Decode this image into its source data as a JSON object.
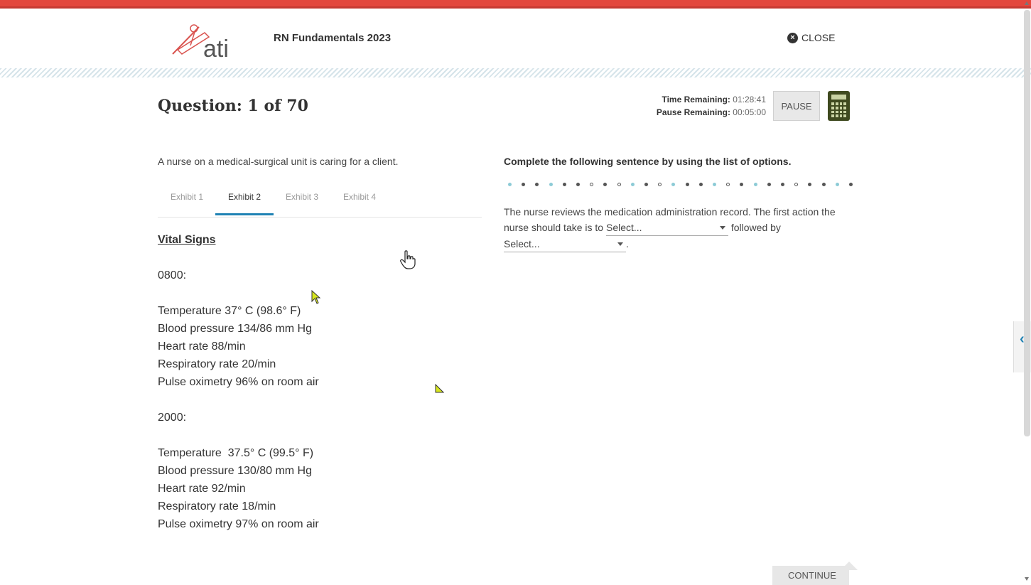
{
  "header": {
    "logo_text": "ati",
    "app_title": "RN Fundamentals 2023",
    "close_label": "CLOSE"
  },
  "question": {
    "title": "Question: 1 of 70",
    "time_remaining_label": "Time Remaining:",
    "time_remaining_value": "01:28:41",
    "pause_remaining_label": "Pause Remaining:",
    "pause_remaining_value": "00:05:00",
    "pause_label": "PAUSE"
  },
  "stem": "A nurse on a medical-surgical unit is caring for a client.",
  "tabs": [
    {
      "label": "Exhibit 1",
      "active": false
    },
    {
      "label": "Exhibit 2",
      "active": true
    },
    {
      "label": "Exhibit 3",
      "active": false
    },
    {
      "label": "Exhibit 4",
      "active": false
    }
  ],
  "exhibit": {
    "heading": "Vital Signs",
    "time1": "0800:",
    "vitals1": [
      "Temperature 37° C (98.6° F)",
      "Blood pressure 134/86 mm Hg",
      "Heart rate 88/min",
      "Respiratory rate 20/min",
      "Pulse oximetry 96% on room air"
    ],
    "time2": "2000:",
    "vitals2": [
      "Temperature  37.5° C (99.5° F)",
      "Blood pressure 130/80 mm Hg",
      "Heart rate 92/min",
      "Respiratory rate 18/min",
      "Pulse oximetry 97% on room air"
    ]
  },
  "task": {
    "instructions": "Complete the following sentence by using the list of options.",
    "sentence_part1": "The nurse reviews the medication administration record. The first action the nurse should take is to",
    "select1_value": "Select...",
    "sentence_part2": "followed by",
    "select2_value": "Select...",
    "sentence_end": "."
  },
  "footer": {
    "continue_label": "CONTINUE"
  },
  "colors": {
    "top_bar": "#e3473d",
    "tab_active_underline": "#1f82b4",
    "calculator": "#3f4a1f",
    "dot_teal": "#8ccbd6",
    "dot_gray": "#555555"
  },
  "icons": {
    "close": "close-circle-icon",
    "calculator": "calculator-icon",
    "side_panel": "chevron-left-icon",
    "select_arrow": "caret-down-icon"
  }
}
